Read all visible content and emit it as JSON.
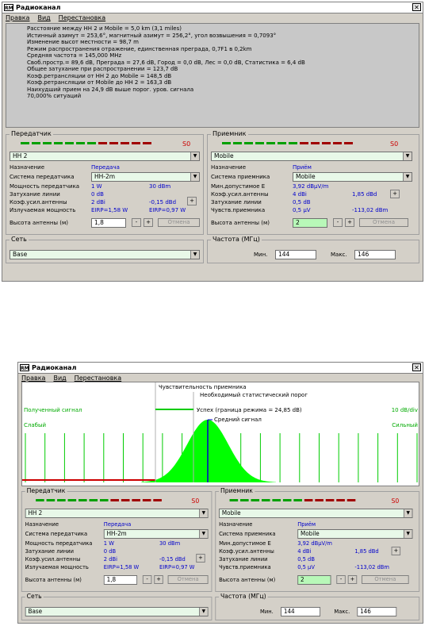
{
  "window1": {
    "title": "Радиоканал",
    "menu": [
      "Правка",
      "Вид",
      "Перестановка"
    ],
    "info_lines": [
      "Расстояние между НН 2 и Mobile = 5,0 km (3,1 miles)",
      "Истинный азимут = 253,6°, магнитный азимут = 256,2°, угол возвышения = 0,7093°",
      "Изменение высот местности = 98,7 m",
      "Режим распространения отражение, единственная преграда, 0,7F1 в 0,2km",
      "Средняя частота = 145,000 MHz",
      "Своб.простр.= 89,6 dB, Преграда = 27,6 dB, Город = 0,0 dB, Лес = 0,0 dB, Статистика = 6,4 dB",
      "Общее затухание при распространении = 123,7 dB",
      "Коэф.ретрансляции от НН 2 до Mobile = 148,5 dB",
      "Коэф.ретрансляции от Mobile до НН 2 = 163,3 dB",
      "Наихудший прием на 24,9 dB выше порог. уров. сигнала",
      "70,000% ситуаций"
    ]
  },
  "window2": {
    "title": "Радиоканал",
    "menu": [
      "Правка",
      "Вид",
      "Перестановка"
    ],
    "chart_data": {
      "type": "area",
      "annotations": {
        "rx_sensitivity": "Чувствительность приемника",
        "required_threshold": "Необходимый статистический порог",
        "success": "Успех (граница режима = 24,85 dB)",
        "mean_signal": "Средний сигнал"
      },
      "left_top": "Полученный сигнал",
      "left_weak": "Слабый",
      "right_top": "10 dB/div",
      "right_strong": "Сильный",
      "colors": {
        "area": "#00ff00",
        "grid": "#00cc00",
        "baseline": "#cc0000",
        "mean": "#0000cc",
        "threshold": "#00cc00"
      }
    }
  },
  "panel": {
    "tx": {
      "group": "Передатчик",
      "s_value": "S0",
      "station": "НН 2",
      "purpose_label": "Назначение",
      "purpose_value": "Передача",
      "system_label": "Система передатчика",
      "system_value": "НН-2m",
      "power_label": "Мощность передатчика",
      "power_w": "1 W",
      "power_dbm": "30 dBm",
      "loss_label": "Затухание линии",
      "loss_value": "0 dB",
      "gain_label": "Коэф.усил.антенны",
      "gain_dbi": "2 dBi",
      "gain_dbd": "-0,15 dBd",
      "plus": "+",
      "erp_label": "Излучаемая мощность",
      "eirp": "EIRP=1,58 W",
      "erp": "EIRP=0,97 W",
      "height_label": "Высота антенны (м)",
      "height_value": "1,8",
      "minus": "-",
      "cancel": "Отмена"
    },
    "rx": {
      "group": "Приемник",
      "s_value": "S0",
      "station": "Mobile",
      "purpose_label": "Назначение",
      "purpose_value": "Приём",
      "system_label": "Система приемника",
      "system_value": "Mobile",
      "minfield_label": "Мин.допустимое Е",
      "minfield_value": "3,92 dBμV/m",
      "gain_label": "Коэф.усил.антенны",
      "gain_dbi": "4 dBi",
      "gain_dbd": "1,85 dBd",
      "plus": "+",
      "loss_label": "Затухание линии",
      "loss_value": "0,5 dB",
      "sens_label": "Чувств.приемника",
      "sens_uv": "0,5 μV",
      "sens_dbm": "-113,02 dBm",
      "height_label": "Высота антенны (м)",
      "height_value": "2",
      "minus": "-",
      "cancel": "Отмена"
    },
    "net": {
      "group": "Сеть",
      "value": "Base"
    },
    "freq": {
      "group": "Частота (МГц)",
      "min_label": "Мин.",
      "min_value": "144",
      "max_label": "Макс.",
      "max_value": "146"
    }
  }
}
